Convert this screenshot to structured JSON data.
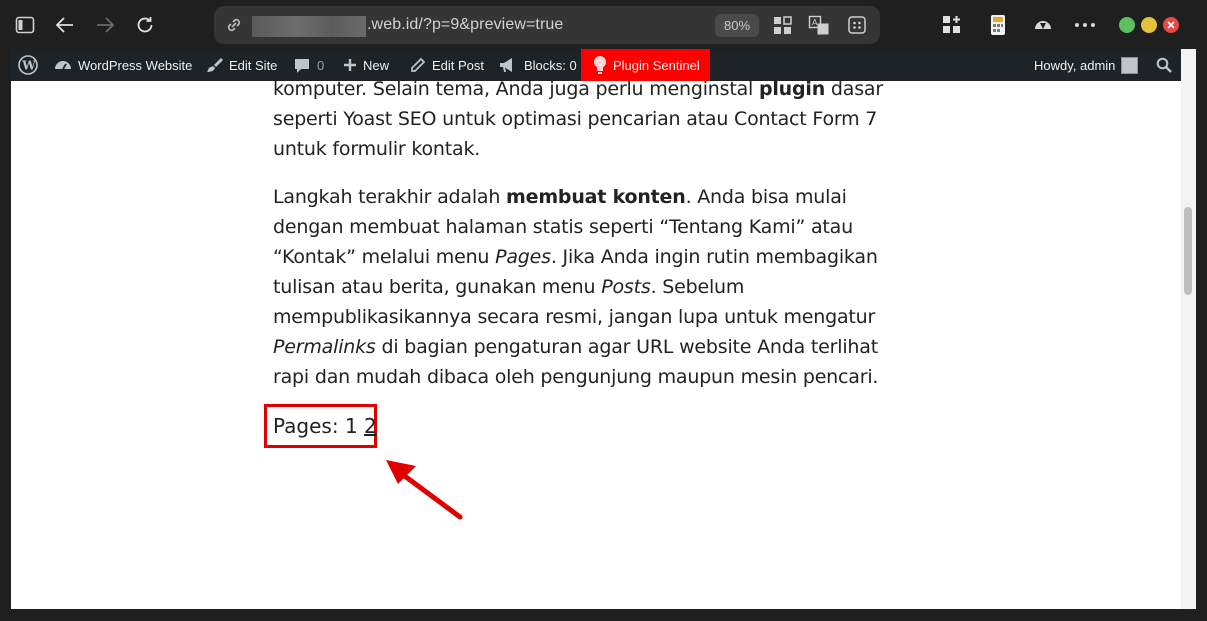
{
  "browser": {
    "url_suffix": ".web.id/?p=9&preview=true",
    "zoom": "80%",
    "window_controls": {
      "minimize_color": "#5cc15c",
      "maximize_color": "#e3c23b",
      "close_color": "#e8464a"
    },
    "icons": [
      "sidebar-icon",
      "back-icon",
      "forward-icon",
      "reload-icon",
      "link-icon",
      "apps-icon",
      "translate-icon",
      "reader-icon",
      "extensions-icon",
      "calculator-icon",
      "shield-icon",
      "more-icon"
    ]
  },
  "adminbar": {
    "site_name": "WordPress Website",
    "edit_site": "Edit Site",
    "comments_count": "0",
    "new_label": "New",
    "edit_post": "Edit Post",
    "blocks_label": "Blocks: 0",
    "plugin_label": "Plugin Sentinel",
    "howdy": "Howdy, admin",
    "accent_color": "#ff0000"
  },
  "article": {
    "p1_part1": "komputer. Selain tema, Anda juga perlu menginstal ",
    "p1_bold": "plugin",
    "p1_part2": " dasar seperti Yoast SEO untuk optimasi pencarian atau Contact Form 7 untuk formulir kontak.",
    "p2_part1": "Langkah terakhir adalah ",
    "p2_bold": "membuat konten",
    "p2_part2": ". Anda bisa mulai dengan membuat halaman statis seperti “Tentang Kami” atau “Kontak” melalui menu ",
    "p2_italic1": "Pages",
    "p2_part3": ". Jika Anda ingin rutin membagikan tulisan atau berita, gunakan menu ",
    "p2_italic2": "Posts",
    "p2_part4": ". Sebelum mempublikasikannya secara resmi, jangan lupa untuk mengatur ",
    "p2_italic3": "Permalinks",
    "p2_part5": " di bagian pengaturan agar URL website Anda terlihat rapi dan mudah dibaca oleh pengunjung maupun mesin pencari."
  },
  "pagination": {
    "label": "Pages:",
    "page1": "1",
    "page2": "2",
    "highlight_color": "#e00000"
  }
}
